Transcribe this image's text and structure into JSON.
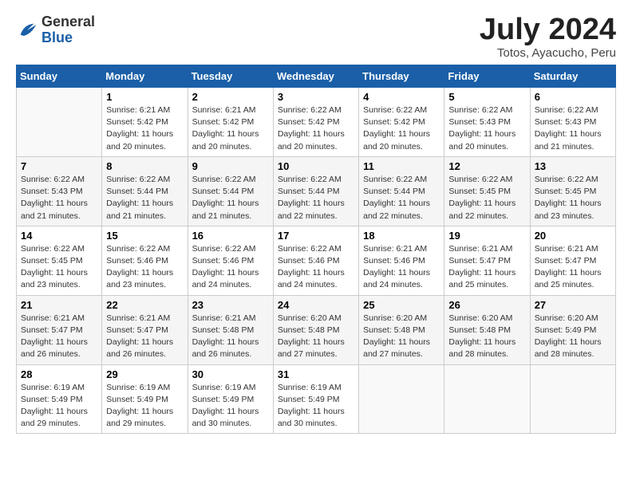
{
  "logo": {
    "general": "General",
    "blue": "Blue"
  },
  "title": "July 2024",
  "location": "Totos, Ayacucho, Peru",
  "days_of_week": [
    "Sunday",
    "Monday",
    "Tuesday",
    "Wednesday",
    "Thursday",
    "Friday",
    "Saturday"
  ],
  "weeks": [
    [
      {
        "num": "",
        "info": ""
      },
      {
        "num": "1",
        "info": "Sunrise: 6:21 AM\nSunset: 5:42 PM\nDaylight: 11 hours\nand 20 minutes."
      },
      {
        "num": "2",
        "info": "Sunrise: 6:21 AM\nSunset: 5:42 PM\nDaylight: 11 hours\nand 20 minutes."
      },
      {
        "num": "3",
        "info": "Sunrise: 6:22 AM\nSunset: 5:42 PM\nDaylight: 11 hours\nand 20 minutes."
      },
      {
        "num": "4",
        "info": "Sunrise: 6:22 AM\nSunset: 5:42 PM\nDaylight: 11 hours\nand 20 minutes."
      },
      {
        "num": "5",
        "info": "Sunrise: 6:22 AM\nSunset: 5:43 PM\nDaylight: 11 hours\nand 20 minutes."
      },
      {
        "num": "6",
        "info": "Sunrise: 6:22 AM\nSunset: 5:43 PM\nDaylight: 11 hours\nand 21 minutes."
      }
    ],
    [
      {
        "num": "7",
        "info": "Sunrise: 6:22 AM\nSunset: 5:43 PM\nDaylight: 11 hours\nand 21 minutes."
      },
      {
        "num": "8",
        "info": "Sunrise: 6:22 AM\nSunset: 5:44 PM\nDaylight: 11 hours\nand 21 minutes."
      },
      {
        "num": "9",
        "info": "Sunrise: 6:22 AM\nSunset: 5:44 PM\nDaylight: 11 hours\nand 21 minutes."
      },
      {
        "num": "10",
        "info": "Sunrise: 6:22 AM\nSunset: 5:44 PM\nDaylight: 11 hours\nand 22 minutes."
      },
      {
        "num": "11",
        "info": "Sunrise: 6:22 AM\nSunset: 5:44 PM\nDaylight: 11 hours\nand 22 minutes."
      },
      {
        "num": "12",
        "info": "Sunrise: 6:22 AM\nSunset: 5:45 PM\nDaylight: 11 hours\nand 22 minutes."
      },
      {
        "num": "13",
        "info": "Sunrise: 6:22 AM\nSunset: 5:45 PM\nDaylight: 11 hours\nand 23 minutes."
      }
    ],
    [
      {
        "num": "14",
        "info": "Sunrise: 6:22 AM\nSunset: 5:45 PM\nDaylight: 11 hours\nand 23 minutes."
      },
      {
        "num": "15",
        "info": "Sunrise: 6:22 AM\nSunset: 5:46 PM\nDaylight: 11 hours\nand 23 minutes."
      },
      {
        "num": "16",
        "info": "Sunrise: 6:22 AM\nSunset: 5:46 PM\nDaylight: 11 hours\nand 24 minutes."
      },
      {
        "num": "17",
        "info": "Sunrise: 6:22 AM\nSunset: 5:46 PM\nDaylight: 11 hours\nand 24 minutes."
      },
      {
        "num": "18",
        "info": "Sunrise: 6:21 AM\nSunset: 5:46 PM\nDaylight: 11 hours\nand 24 minutes."
      },
      {
        "num": "19",
        "info": "Sunrise: 6:21 AM\nSunset: 5:47 PM\nDaylight: 11 hours\nand 25 minutes."
      },
      {
        "num": "20",
        "info": "Sunrise: 6:21 AM\nSunset: 5:47 PM\nDaylight: 11 hours\nand 25 minutes."
      }
    ],
    [
      {
        "num": "21",
        "info": "Sunrise: 6:21 AM\nSunset: 5:47 PM\nDaylight: 11 hours\nand 26 minutes."
      },
      {
        "num": "22",
        "info": "Sunrise: 6:21 AM\nSunset: 5:47 PM\nDaylight: 11 hours\nand 26 minutes."
      },
      {
        "num": "23",
        "info": "Sunrise: 6:21 AM\nSunset: 5:48 PM\nDaylight: 11 hours\nand 26 minutes."
      },
      {
        "num": "24",
        "info": "Sunrise: 6:20 AM\nSunset: 5:48 PM\nDaylight: 11 hours\nand 27 minutes."
      },
      {
        "num": "25",
        "info": "Sunrise: 6:20 AM\nSunset: 5:48 PM\nDaylight: 11 hours\nand 27 minutes."
      },
      {
        "num": "26",
        "info": "Sunrise: 6:20 AM\nSunset: 5:48 PM\nDaylight: 11 hours\nand 28 minutes."
      },
      {
        "num": "27",
        "info": "Sunrise: 6:20 AM\nSunset: 5:49 PM\nDaylight: 11 hours\nand 28 minutes."
      }
    ],
    [
      {
        "num": "28",
        "info": "Sunrise: 6:19 AM\nSunset: 5:49 PM\nDaylight: 11 hours\nand 29 minutes."
      },
      {
        "num": "29",
        "info": "Sunrise: 6:19 AM\nSunset: 5:49 PM\nDaylight: 11 hours\nand 29 minutes."
      },
      {
        "num": "30",
        "info": "Sunrise: 6:19 AM\nSunset: 5:49 PM\nDaylight: 11 hours\nand 30 minutes."
      },
      {
        "num": "31",
        "info": "Sunrise: 6:19 AM\nSunset: 5:49 PM\nDaylight: 11 hours\nand 30 minutes."
      },
      {
        "num": "",
        "info": ""
      },
      {
        "num": "",
        "info": ""
      },
      {
        "num": "",
        "info": ""
      }
    ]
  ]
}
